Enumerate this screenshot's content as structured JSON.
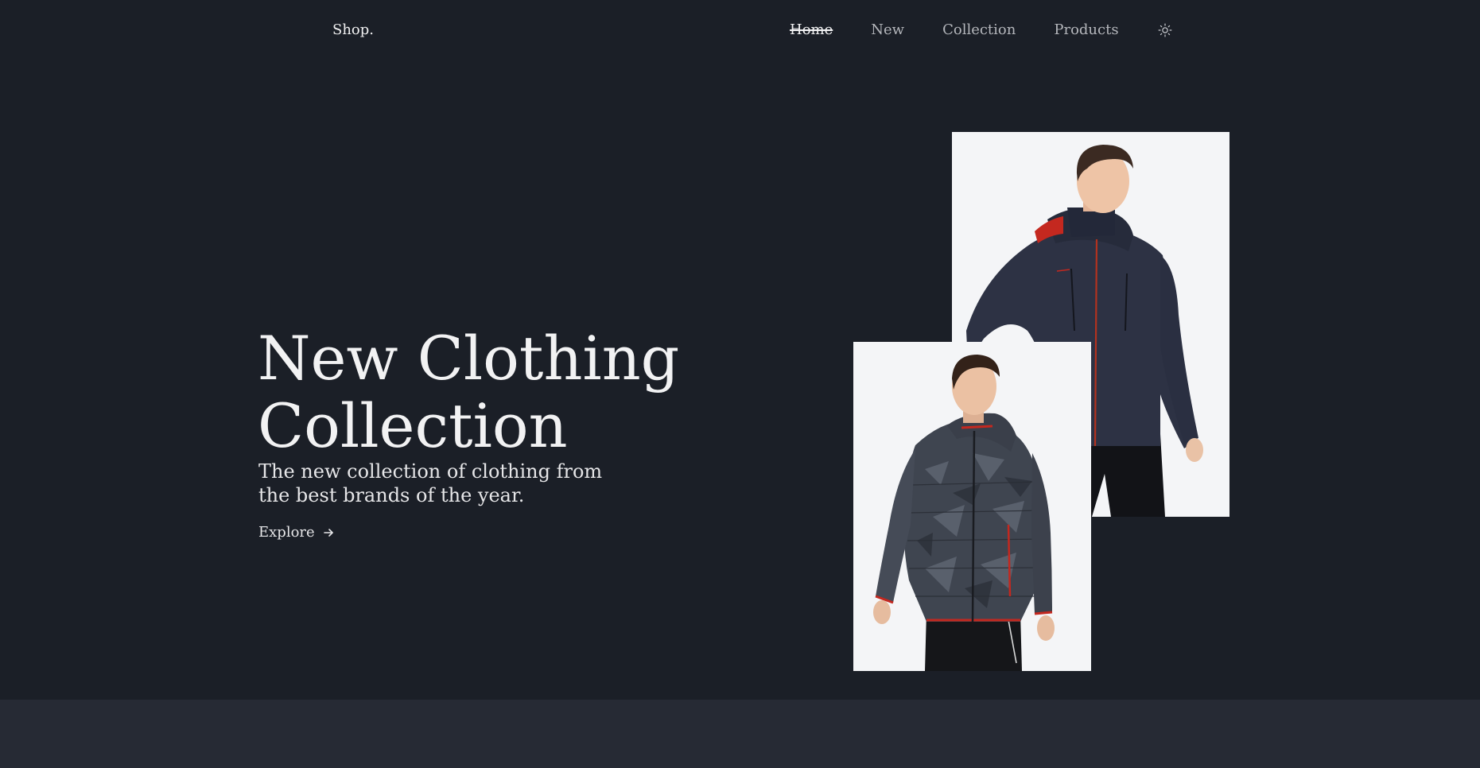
{
  "header": {
    "logo": "Shop.",
    "nav": [
      {
        "label": "Home",
        "active": true
      },
      {
        "label": "New",
        "active": false
      },
      {
        "label": "Collection",
        "active": false
      },
      {
        "label": "Products",
        "active": false
      }
    ],
    "theme_icon": "sun-icon"
  },
  "hero": {
    "title_line1": "New Clothing",
    "title_line2": "Collection",
    "subtitle": "The new collection of clothing from the best brands of the year.",
    "cta_label": "Explore",
    "cta_icon": "arrow-right-icon"
  },
  "colors": {
    "background": "#1b1f27",
    "footer_band": "#262a34",
    "photo_background": "#f4f5f7",
    "accent_red": "#c4281f"
  }
}
